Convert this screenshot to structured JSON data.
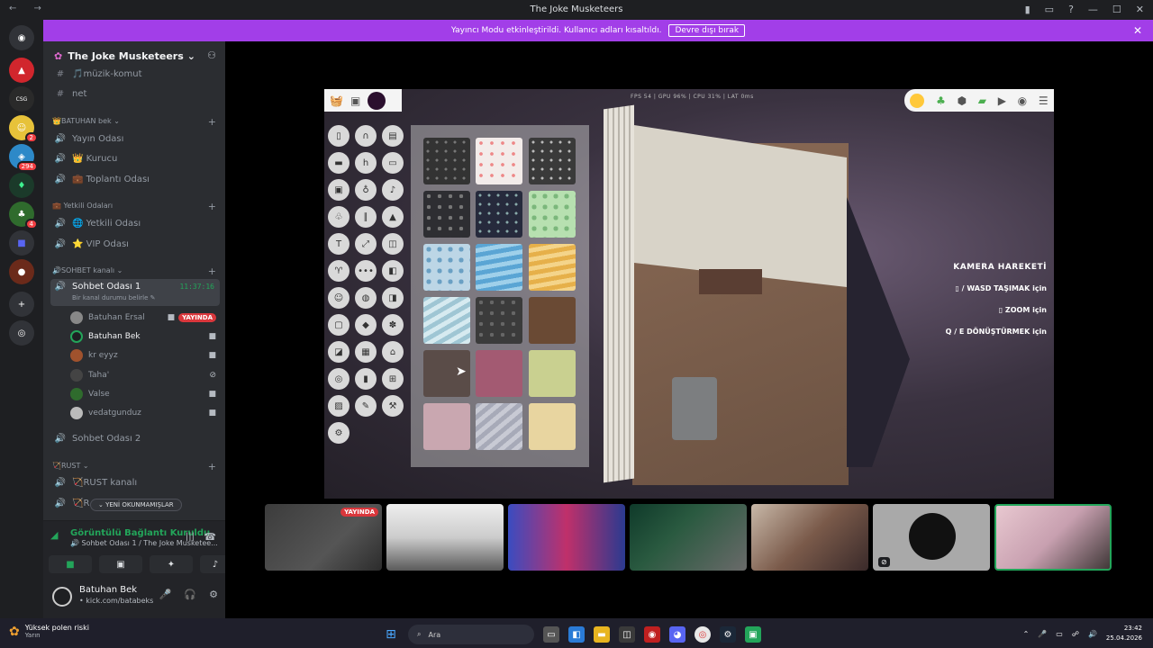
{
  "window": {
    "title": "The Joke Musketeers",
    "nav": "← →"
  },
  "banner": {
    "text": "Yayıncı Modu etkinleştirildi. Kullanıcı adları kısaltıldı.",
    "button": "Devre dışı bırak"
  },
  "server": {
    "name": "The Joke Musketeers"
  },
  "servers": {
    "badges": [
      "2",
      "294",
      "4"
    ]
  },
  "channels": [
    {
      "label": "🎵müzik-komut",
      "icon": "#"
    },
    {
      "label": "net",
      "icon": "#"
    }
  ],
  "categories": {
    "batuhan": "👑BATUHAN bek",
    "yetkili": "💼 Yetkili Odaları",
    "sohbet": "🔊SOHBET kanalı",
    "rust": "🏹RUST"
  },
  "voice": {
    "yayin": "Yayın Odası",
    "kurucu": "👑 Kurucu",
    "toplanti": "💼 Toplantı Odası",
    "yetkili": "🌐 Yetkili Odası",
    "vip": "⭐ VIP Odası",
    "sohbet1": "Sohbet Odası 1",
    "sohbet1_time": "11:37:16",
    "sohbet1_status": "Bir kanal durumu belirle ✎",
    "sohbet2": "Sohbet Odası 2",
    "rust1": "🏹RUST kanalı",
    "rust2": "🏹R"
  },
  "users": [
    {
      "name": "Batuhan Ersal",
      "live": "YAYINDA"
    },
    {
      "name": "Batuhan Bek"
    },
    {
      "name": "kr eyyz"
    },
    {
      "name": "Taha'"
    },
    {
      "name": "Valse"
    },
    {
      "name": "vedatgunduz"
    }
  ],
  "unread": "⌄ YENİ OKUNMAMIŞLAR",
  "voice_panel": {
    "status": "Görüntülü Bağlantı Kuruldu",
    "sub": "🔊 Sohbet Odası 1 / The Joke Musketee..."
  },
  "user_panel": {
    "name": "Batuhan Bek",
    "tag": "• kick.com/batabeks"
  },
  "game": {
    "stats": "FPS 54 | GPU 96% | CPU 31% | LAT 0ms",
    "help_title": "KAMERA HAREKETİ",
    "help1": "/ WASD  TAŞIMAK için",
    "help2": "ZOOM için",
    "help3": "Q / E DÖNÜŞTÜRMEK için"
  },
  "thumbs": {
    "live": "YAYINDA"
  },
  "taskbar": {
    "weather1": "Yüksek polen riski",
    "weather2": "Yarın",
    "search": "Ara",
    "time": "23:42",
    "date": "25.04.2026"
  },
  "colors": {
    "accent": "#a23ee8",
    "green": "#23a55a",
    "red": "#da373c"
  }
}
